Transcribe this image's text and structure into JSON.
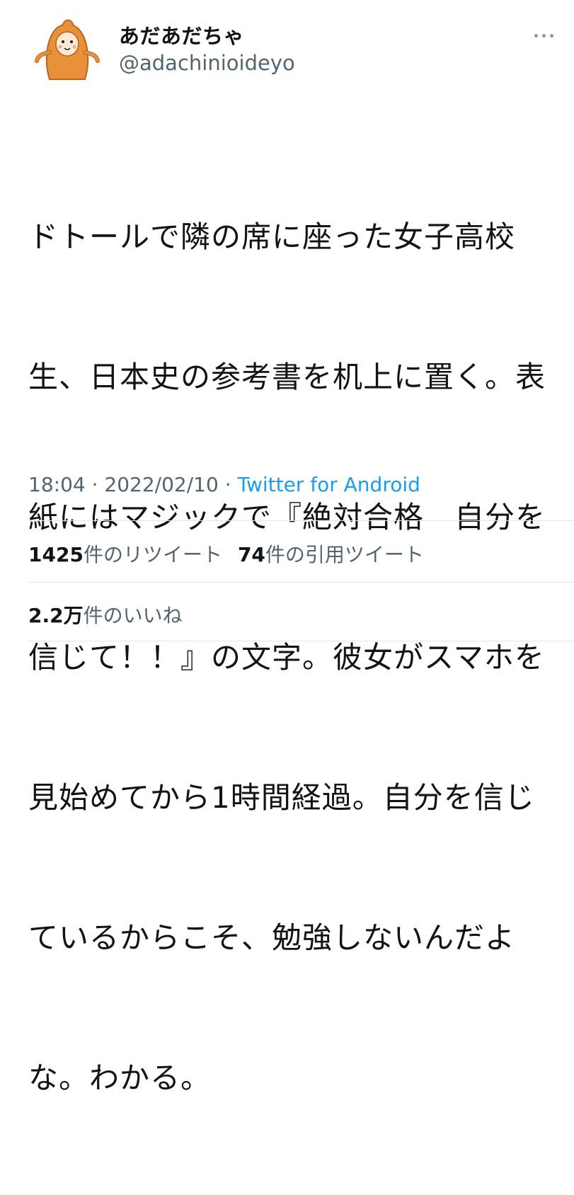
{
  "user": {
    "display_name": "あだあだちゃ",
    "handle": "@adachinioideyo",
    "avatar_icon": "mascot-avatar-icon"
  },
  "tweet": {
    "lines": [
      "ドトールで隣の席に座った女子高校",
      "生、日本史の参考書を机上に置く。表",
      "紙にはマジックで『絶対合格　自分を",
      "信じて！！』の文字。彼女がスマホを",
      "見始めてから1時間経過。自分を信じ",
      "ているからこそ、勉強しないんだよ",
      "な。わかる。"
    ]
  },
  "meta": {
    "time": "18:04",
    "separator": " · ",
    "date": "2022/02/10",
    "source": "Twitter for Android"
  },
  "stats": {
    "retweets_count": "1425",
    "retweets_label": "件のリツイート",
    "quotes_count": "74",
    "quotes_label": "件の引用ツイート",
    "likes_count": "2.2万",
    "likes_label": "件のいいね"
  },
  "colors": {
    "accent": "#1d9bf0",
    "secondary_text": "#536471",
    "primary_text": "#0f1419",
    "avatar_orange": "#e8913a"
  }
}
